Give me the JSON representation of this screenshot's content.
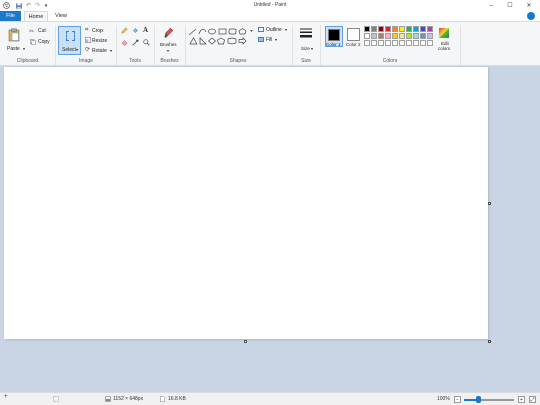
{
  "window": {
    "title": "Untitled - Paint",
    "minimize": "–",
    "maximize": "☐",
    "close": "✕"
  },
  "quick_access": {
    "app_icon": "paint-app-icon",
    "save_icon": "save-icon",
    "undo_icon": "undo-icon",
    "redo_icon": "redo-icon",
    "customize": "▾"
  },
  "tabs": {
    "file": "File",
    "home": "Home",
    "view": "View"
  },
  "ribbon": {
    "clipboard": {
      "label": "Clipboard",
      "paste": "Paste",
      "cut": "Cut",
      "copy": "Copy"
    },
    "image": {
      "label": "Image",
      "select": "Select",
      "crop": "Crop",
      "resize": "Resize",
      "rotate": "Rotate"
    },
    "tools": {
      "label": "Tools"
    },
    "brushes": {
      "label": "Brushes",
      "button": "Brushes"
    },
    "shapes": {
      "label": "Shapes",
      "outline": "Outline",
      "fill": "Fill"
    },
    "size": {
      "label": "Size",
      "button": "Size"
    },
    "colors": {
      "label": "Colors",
      "color1": "Color 1",
      "color2": "Color 2",
      "edit_colors_line1": "Edit",
      "edit_colors_line2": "colors",
      "palette_row1": [
        "#000000",
        "#7f7f7f",
        "#880015",
        "#ed1c24",
        "#ff7f27",
        "#fff200",
        "#22b14c",
        "#00a2e8",
        "#3f48cc",
        "#a349a4"
      ],
      "palette_row2": [
        "#ffffff",
        "#c3c3c3",
        "#b97a57",
        "#ffaec9",
        "#ffc90e",
        "#efe4b0",
        "#b5e61d",
        "#99d9ea",
        "#7092be",
        "#c8bfe7"
      ],
      "palette_row3": [
        "#ffffff",
        "#ffffff",
        "#ffffff",
        "#ffffff",
        "#ffffff",
        "#ffffff",
        "#ffffff",
        "#ffffff",
        "#ffffff",
        "#ffffff"
      ]
    }
  },
  "status": {
    "dimensions": "1152 × 648px",
    "file_size": "16.8 KB",
    "zoom": "100%",
    "zoom_level": 0.28
  },
  "accent": "#1979ca",
  "workspace_bg": "#c9d4e5"
}
